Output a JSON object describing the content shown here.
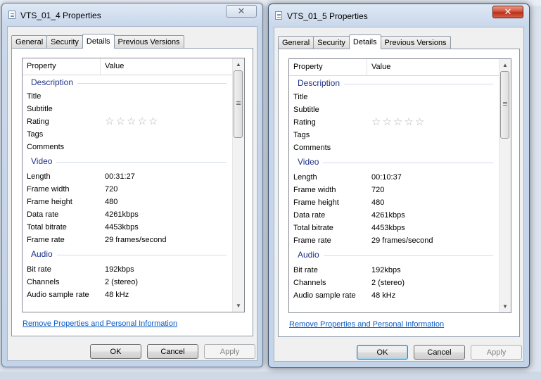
{
  "windows": [
    {
      "title": "VTS_01_4 Properties",
      "close_label": "✕",
      "tabs": [
        "General",
        "Security",
        "Details",
        "Previous Versions"
      ],
      "selected_tab": "Details",
      "header": {
        "property": "Property",
        "value": "Value"
      },
      "groups": {
        "description": "Description",
        "video": "Video",
        "audio": "Audio"
      },
      "rows": {
        "title": {
          "label": "Title",
          "value": ""
        },
        "subtitle": {
          "label": "Subtitle",
          "value": ""
        },
        "rating": {
          "label": "Rating",
          "stars": 0,
          "max": 5
        },
        "tags": {
          "label": "Tags",
          "value": ""
        },
        "comments": {
          "label": "Comments",
          "value": ""
        },
        "length": {
          "label": "Length",
          "value": "00:31:27"
        },
        "frame_width": {
          "label": "Frame width",
          "value": "720"
        },
        "frame_height": {
          "label": "Frame height",
          "value": "480"
        },
        "data_rate": {
          "label": "Data rate",
          "value": "4261kbps"
        },
        "total_bitrate": {
          "label": "Total bitrate",
          "value": "4453kbps"
        },
        "frame_rate": {
          "label": "Frame rate",
          "value": "29 frames/second"
        },
        "bit_rate": {
          "label": "Bit rate",
          "value": "192kbps"
        },
        "channels": {
          "label": "Channels",
          "value": "2 (stereo)"
        },
        "audio_sample_rate": {
          "label": "Audio sample rate",
          "value": "48 kHz"
        }
      },
      "remove_link": "Remove Properties and Personal Information",
      "buttons": {
        "ok": "OK",
        "cancel": "Cancel",
        "apply": "Apply"
      }
    },
    {
      "title": "VTS_01_5 Properties",
      "close_label": "✕",
      "tabs": [
        "General",
        "Security",
        "Details",
        "Previous Versions"
      ],
      "selected_tab": "Details",
      "header": {
        "property": "Property",
        "value": "Value"
      },
      "groups": {
        "description": "Description",
        "video": "Video",
        "audio": "Audio"
      },
      "rows": {
        "title": {
          "label": "Title",
          "value": ""
        },
        "subtitle": {
          "label": "Subtitle",
          "value": ""
        },
        "rating": {
          "label": "Rating",
          "stars": 0,
          "max": 5
        },
        "tags": {
          "label": "Tags",
          "value": ""
        },
        "comments": {
          "label": "Comments",
          "value": ""
        },
        "length": {
          "label": "Length",
          "value": "00:10:37"
        },
        "frame_width": {
          "label": "Frame width",
          "value": "720"
        },
        "frame_height": {
          "label": "Frame height",
          "value": "480"
        },
        "data_rate": {
          "label": "Data rate",
          "value": "4261kbps"
        },
        "total_bitrate": {
          "label": "Total bitrate",
          "value": "4453kbps"
        },
        "frame_rate": {
          "label": "Frame rate",
          "value": "29 frames/second"
        },
        "bit_rate": {
          "label": "Bit rate",
          "value": "192kbps"
        },
        "channels": {
          "label": "Channels",
          "value": "2 (stereo)"
        },
        "audio_sample_rate": {
          "label": "Audio sample rate",
          "value": "48 kHz"
        }
      },
      "remove_link": "Remove Properties and Personal Information",
      "buttons": {
        "ok": "OK",
        "cancel": "Cancel",
        "apply": "Apply"
      }
    }
  ],
  "active_window": 1,
  "icons": {
    "window": "file-properties-icon",
    "star": "star-outline-icon",
    "scroll_up": "arrow-up-icon",
    "scroll_down": "arrow-down-icon"
  },
  "colors": {
    "group_header": "#1e3287",
    "link": "#0a5bc4",
    "close_active": "#c7442a"
  }
}
